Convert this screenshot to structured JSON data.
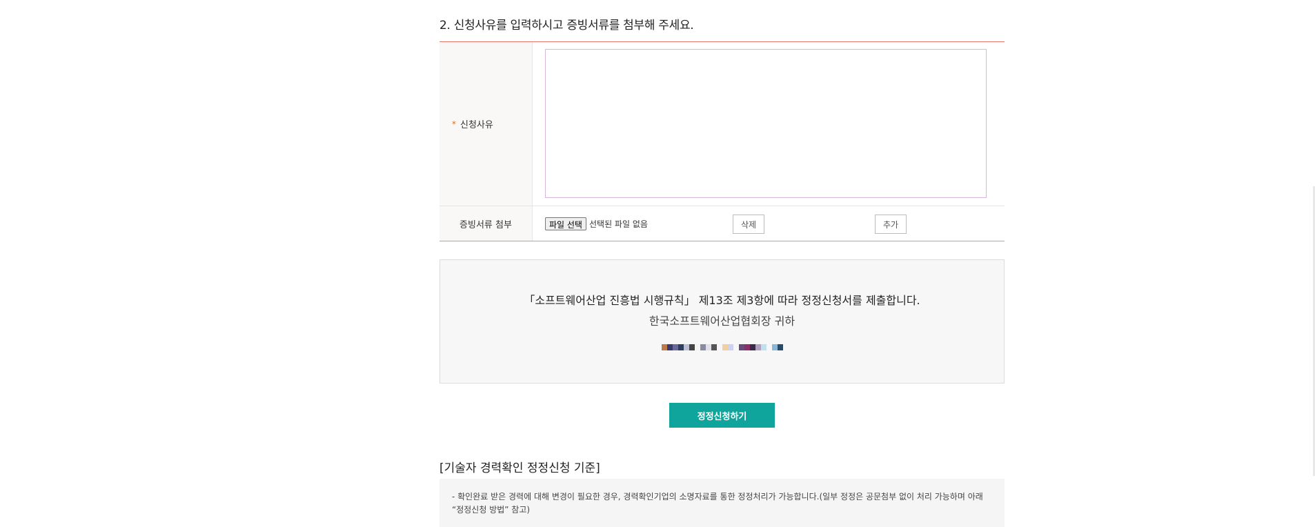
{
  "section": {
    "title": "2. 신청사유를 입력하시고 증빙서류를 첨부해 주세요."
  },
  "form": {
    "reason": {
      "required_mark": "*",
      "label": "신청사유",
      "value": ""
    },
    "attachment": {
      "label": "증빙서류 첨부",
      "file_button_label": "파일 선택",
      "file_status": "선택된 파일 없음",
      "delete_label": "삭제",
      "add_label": "추가"
    }
  },
  "declaration": {
    "line1": "「소프트웨어산업 진흥법 시행규칙」 제13조 제3항에 따라 정정신청서를 제출합니다.",
    "line2": "한국소프트웨어산업협회장 귀하"
  },
  "submit": {
    "label": "정정신청하기"
  },
  "criteria": {
    "title": "[기술자 경력확인 정정신청 기준]",
    "text": "- 확인완료 받은 경력에 대해 변경이 필요한 경우, 경력확인기업의 소명자료를 통한 정정처리가 가능합니다.(일부 정정은 공문첨부 없이 처리 가능하며 아래 “정정신청 방법” 참고)"
  },
  "colors": {
    "accent": "#10a59c",
    "table_top_border": "#e5746b",
    "required": "#e56b1f"
  }
}
